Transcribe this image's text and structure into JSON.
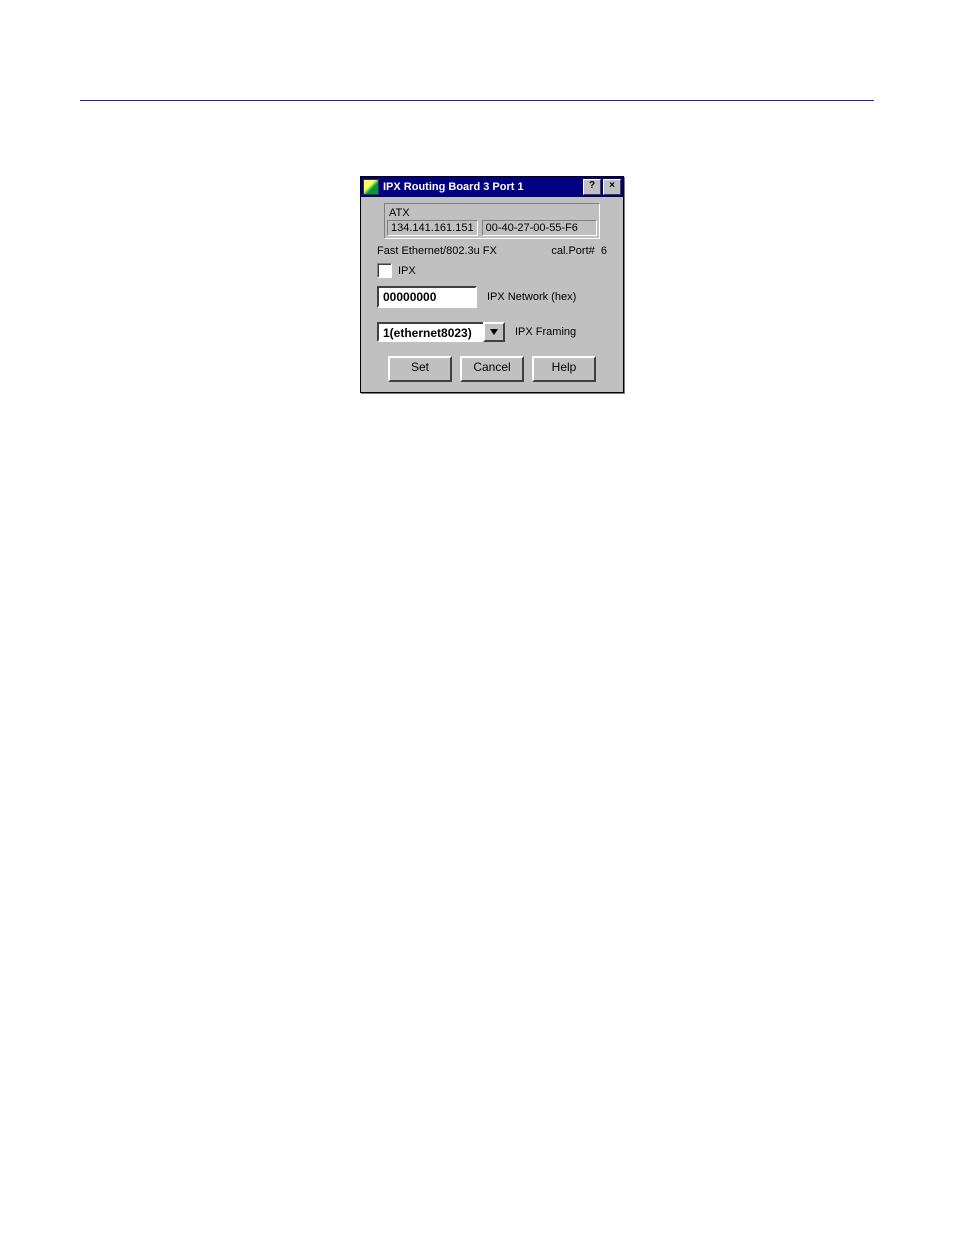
{
  "dialog": {
    "title": "IPX Routing Board 3 Port 1",
    "help_glyph": "?",
    "close_glyph": "×",
    "info": {
      "device_name": "ATX",
      "ip": "134.141.161.151",
      "mac": "00-40-27-00-55-F6"
    },
    "media_label": "Fast Ethernet/802.3u FX",
    "cal_port_label": "cal.Port#",
    "cal_port_value": "6",
    "ipx_checkbox_label": "IPX",
    "ipx_network_value": "00000000",
    "ipx_network_label": "IPX Network (hex)",
    "ipx_framing_value": "1(ethernet8023)",
    "ipx_framing_label": "IPX Framing",
    "buttons": {
      "set": "Set",
      "cancel": "Cancel",
      "help": "Help"
    }
  }
}
